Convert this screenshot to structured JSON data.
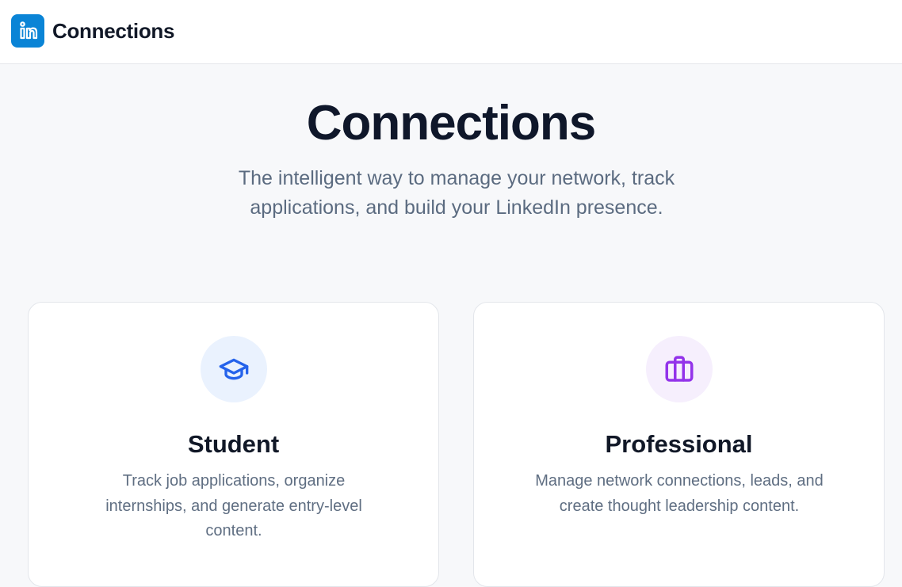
{
  "header": {
    "logo_icon": "linkedin-icon",
    "brand": "Connections"
  },
  "hero": {
    "title": "Connections",
    "subtitle": "The intelligent way to manage your network, track applications, and build your LinkedIn presence."
  },
  "cards": [
    {
      "icon": "graduation-cap-icon",
      "icon_color": "#2563eb",
      "title": "Student",
      "description": "Track job applications, organize internships, and generate entry-level content."
    },
    {
      "icon": "briefcase-icon",
      "icon_color": "#9333ea",
      "title": "Professional",
      "description": "Manage network connections, leads, and create thought leadership content."
    }
  ],
  "colors": {
    "brand_blue": "#0a84d6",
    "page_background": "#f7f8fa",
    "title_text": "#0f172a",
    "muted_text": "#5b6b80"
  }
}
